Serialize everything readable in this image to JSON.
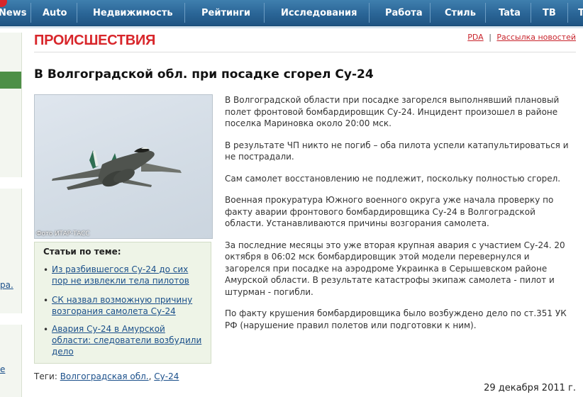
{
  "nav": {
    "items": [
      "News",
      "Auto",
      "Недвижимость",
      "Рейтинги",
      "Исследования",
      "Работа",
      "Стиль",
      "Tata",
      "ТВ",
      "Т"
    ]
  },
  "sidebar": {
    "fragments": [
      "ра.",
      "е"
    ]
  },
  "section": {
    "title": "ПРОИСШЕСТВИЯ",
    "links": {
      "pda": "PDA",
      "separator": "|",
      "newsletter": "Рассылка новостей"
    }
  },
  "article": {
    "headline": "В Волгоградской обл. при посадке сгорел Су-24",
    "photo_credit": "Фото ИТАР-ТАСС",
    "paragraphs": [
      "В Волгоградской области при посадке загорелся выполнявший плановый полет фронтовой бомбардировщик Су-24. Инцидент произошел в районе поселка Мариновка около 20:00 мск.",
      "В результате ЧП никто не погиб – оба пилота успели катапультироваться и не пострадали.",
      "Сам самолет восстановлению не подлежит, поскольку полностью сгорел.",
      "Военная прокуратура Южного военного округа уже начала проверку по факту аварии фронтового бомбардировщика Су-24 в Волгоградской области. Устанавливаются причины возгорания самолета.",
      "За последние месяцы это уже вторая крупная авария с участием Су-24. 20 октября в 06:02 мск бомбардировщик этой модели перевернулся и загорелся при посадке на аэродроме Украинка в Серышевском районе Амурской области. В результате катастрофы экипаж самолета - пилот и штурман - погибли.",
      "По факту крушения бомбардировщика было возбуждено дело по ст.351 УК РФ (нарушение правил полетов или подготовки к ним)."
    ],
    "date": "29 декабря 2011 г."
  },
  "related": {
    "title": "Статьи по теме:",
    "items": [
      "Из разбившегося Су-24 до сих пор не извлекли тела пилотов",
      "СК назвал возможную причину возгорания самолета Су-24",
      "Авария Су-24 в Амурской области: следователи возбудили дело"
    ]
  },
  "tags": {
    "label": "Теги:",
    "items": [
      "Волгоградская обл.",
      "Су-24"
    ],
    "separator": ","
  },
  "colors": {
    "nav_bg": "#2a6596",
    "section_title": "#d8262b",
    "link": "#1a4f8a",
    "related_bg": "#eef4e7"
  }
}
